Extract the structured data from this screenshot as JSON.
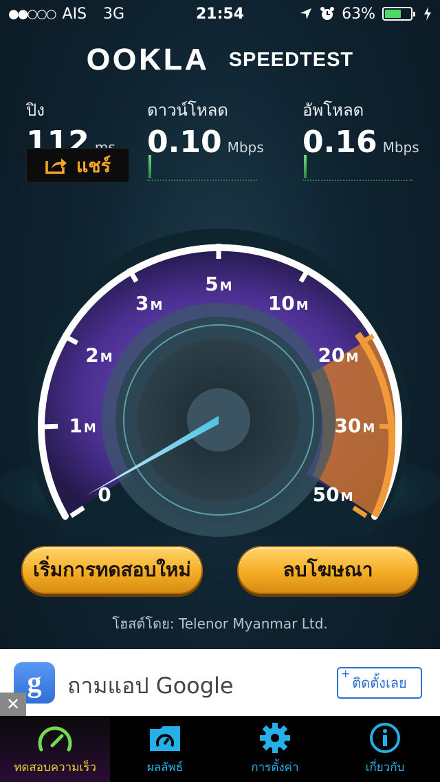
{
  "status_bar": {
    "signal": "●●○○○",
    "carrier": "AIS",
    "network": "3G",
    "time": "21:54",
    "battery": "63%",
    "battery_level": 0.63,
    "icons": [
      "location-icon",
      "alarm-icon",
      "battery-icon",
      "charging-icon"
    ]
  },
  "brand": {
    "logo": "OOKLA",
    "product": "SPEEDTEST"
  },
  "metrics": {
    "ping": {
      "label": "ปิง",
      "value": "112",
      "unit": "ms"
    },
    "download": {
      "label": "ดาวน์โหลด",
      "value": "0.10",
      "unit": "Mbps"
    },
    "upload": {
      "label": "อัพโหลด",
      "value": "0.16",
      "unit": "Mbps"
    }
  },
  "share": {
    "label": "แชร์",
    "icon": "share-icon"
  },
  "gauge": {
    "labels": [
      {
        "value": "0",
        "unit": ""
      },
      {
        "value": "1",
        "unit": "M"
      },
      {
        "value": "2",
        "unit": "M"
      },
      {
        "value": "3",
        "unit": "M"
      },
      {
        "value": "5",
        "unit": "M"
      },
      {
        "value": "10",
        "unit": "M"
      },
      {
        "value": "20",
        "unit": "M"
      },
      {
        "value": "30",
        "unit": "M"
      },
      {
        "value": "50",
        "unit": "M"
      }
    ],
    "needle_reading": 0.16,
    "colors": {
      "accent": "#f09a3a",
      "ring": "#ffffff",
      "dial": "#5a3f9e",
      "needle": "#7fe8ff"
    }
  },
  "buttons": {
    "restart": "เริ่มการทดสอบใหม่",
    "remove_ads": "ลบโฆษณา"
  },
  "host": "โฮสต์โดย: Telenor Myanmar Ltd.",
  "ad": {
    "icon_letter": "g",
    "title": "ถามแอป Google",
    "install": "ติดตั้งเลย",
    "install_plus": "+",
    "close": "✕"
  },
  "tabs": [
    {
      "label": "ทดสอบความเร็ว",
      "icon": "speedometer-icon",
      "active": true
    },
    {
      "label": "ผลลัพธ์",
      "icon": "results-folder-icon",
      "active": false
    },
    {
      "label": "การตั้งค่า",
      "icon": "gear-icon",
      "active": false
    },
    {
      "label": "เกี่ยวกับ",
      "icon": "info-icon",
      "active": false
    }
  ]
}
